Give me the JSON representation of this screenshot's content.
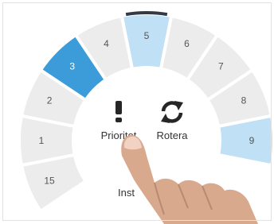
{
  "dial": {
    "segments": [
      {
        "label": "1",
        "state": "normal"
      },
      {
        "label": "2",
        "state": "normal"
      },
      {
        "label": "3",
        "state": "active"
      },
      {
        "label": "4",
        "state": "normal"
      },
      {
        "label": "5",
        "state": "current"
      },
      {
        "label": "6",
        "state": "normal"
      },
      {
        "label": "7",
        "state": "normal"
      },
      {
        "label": "8",
        "state": "normal"
      },
      {
        "label": "9",
        "state": "selected"
      },
      {
        "label": "15",
        "state": "normal"
      }
    ],
    "center": {
      "priority_label": "Prioritet",
      "rotate_label": "Rotera",
      "install_label": "Inst"
    }
  },
  "colors": {
    "segment_normal": "#ececec",
    "segment_active": "#3b9cd9",
    "segment_selected": "#bfe0f5",
    "segment_marker": "#333a45",
    "label_normal": "#555555",
    "label_active": "#ffffff",
    "icon": "#262626"
  }
}
